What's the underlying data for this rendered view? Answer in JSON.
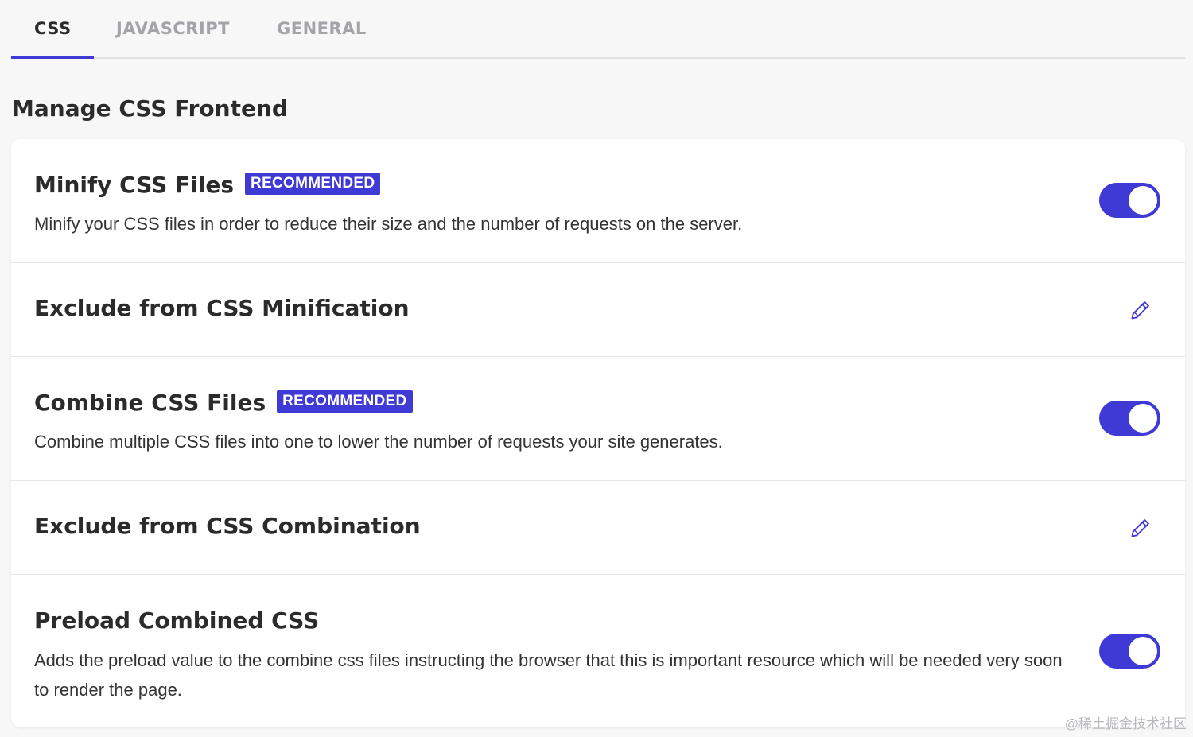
{
  "tabs": [
    {
      "label": "CSS",
      "active": true
    },
    {
      "label": "JAVASCRIPT",
      "active": false
    },
    {
      "label": "GENERAL",
      "active": false
    }
  ],
  "page_title": "Manage CSS Frontend",
  "settings": [
    {
      "title": "Minify CSS Files",
      "badge": "RECOMMENDED",
      "description": "Minify your CSS files in order to reduce their size and the number of requests on the server.",
      "control": "toggle",
      "enabled": true
    },
    {
      "title": "Exclude from CSS Minification",
      "control": "edit"
    },
    {
      "title": "Combine CSS Files",
      "badge": "RECOMMENDED",
      "description": "Combine multiple CSS files into one to lower the number of requests your site generates.",
      "control": "toggle",
      "enabled": true
    },
    {
      "title": "Exclude from CSS Combination",
      "control": "edit"
    },
    {
      "title": "Preload Combined CSS",
      "description": "Adds the preload value to the combine css files instructing the browser that this is important resource which will be needed very soon to render the page.",
      "control": "toggle",
      "enabled": true
    }
  ],
  "icons": {
    "edit": "pencil-icon"
  },
  "colors": {
    "accent": "#3f3ad6",
    "background": "#f7f7f8",
    "card": "#ffffff"
  },
  "watermark": "@稀土掘金技术社区"
}
